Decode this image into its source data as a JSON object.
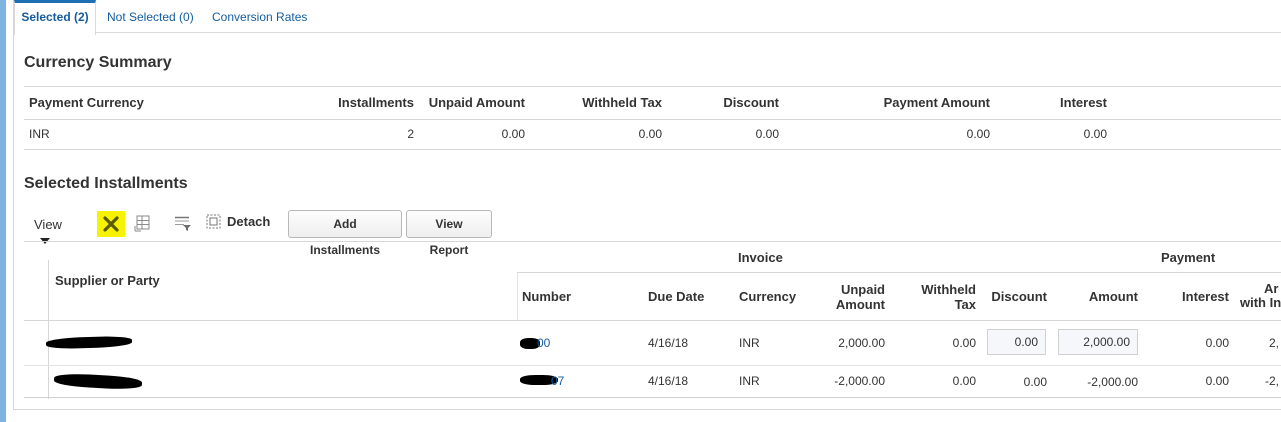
{
  "tabs": [
    {
      "label": "Selected (2)",
      "active": true
    },
    {
      "label": "Not Selected (0)",
      "active": false
    },
    {
      "label": "Conversion Rates",
      "active": false
    }
  ],
  "currency_summary": {
    "title": "Currency Summary",
    "headers": [
      "Payment Currency",
      "Installments",
      "Unpaid Amount",
      "Withheld Tax",
      "Discount",
      "Payment Amount",
      "Interest"
    ],
    "rows": [
      [
        "INR",
        "2",
        "0.00",
        "0.00",
        "0.00",
        "0.00",
        "0.00"
      ]
    ]
  },
  "selected_installments": {
    "title": "Selected Installments",
    "toolbar": {
      "view_label": "View",
      "detach_label": "Detach",
      "add_installments_label": "Add Installments",
      "view_report_label": "View Report",
      "icons": [
        "close-icon",
        "freeze-columns-icon",
        "query-by-example-icon",
        "detach-icon"
      ],
      "highlight_color": "#f7f200"
    },
    "group_headers": {
      "invoice": "Invoice",
      "payment": "Payment"
    },
    "headers": {
      "supplier": "Supplier or Party",
      "number": "Number",
      "due_date": "Due Date",
      "currency": "Currency",
      "unpaid_amount_1": "Unpaid",
      "unpaid_amount_2": "Amount",
      "withheld_tax_1": "Withheld",
      "withheld_tax_2": "Tax",
      "discount": "Discount",
      "amount": "Amount",
      "interest": "Interest",
      "amount_with_interest_1": "Ar",
      "amount_with_interest_2": "with In"
    },
    "rows": [
      {
        "number_suffix": "00",
        "due_date": "4/16/18",
        "currency": "INR",
        "unpaid_amount": "2,000.00",
        "withheld_tax": "0.00",
        "discount": "0.00",
        "amount": "2,000.00",
        "interest": "0.00",
        "amount_with_interest": "2,"
      },
      {
        "number_suffix": "07",
        "due_date": "4/16/18",
        "currency": "INR",
        "unpaid_amount": "-2,000.00",
        "withheld_tax": "0.00",
        "discount": "0.00",
        "amount": "-2,000.00",
        "interest": "0.00",
        "amount_with_interest": "-2,"
      }
    ]
  },
  "colors": {
    "link": "#145c9e",
    "accent": "#1f6fb5",
    "side_bar": "#7fb3e0"
  }
}
